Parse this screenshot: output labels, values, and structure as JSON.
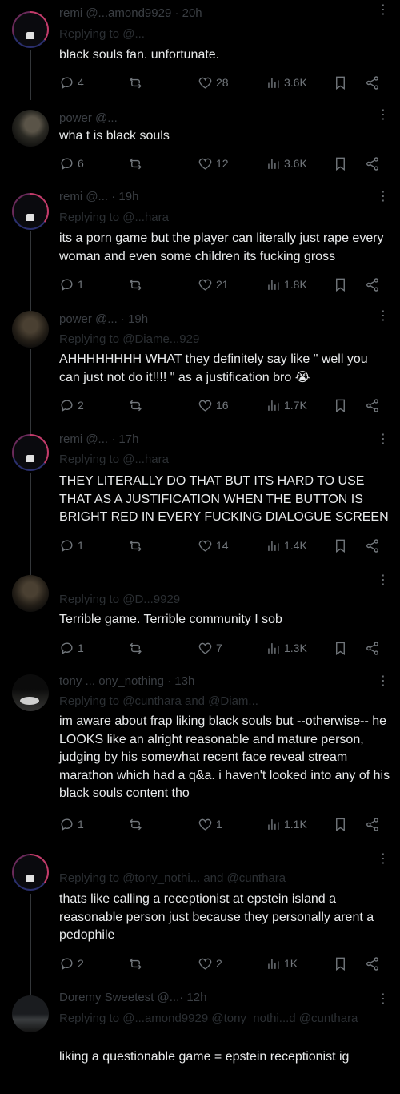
{
  "tweets": [
    {
      "header": "remi @...amond9929 · 20h",
      "replying": "Replying to @...",
      "text": "black souls fan. unfortunate.",
      "replies": "4",
      "reposts": "",
      "likes": "28",
      "views": "3.6K"
    },
    {
      "header": "power @...",
      "replying": "",
      "text": "wha t is black souls",
      "replies": "6",
      "reposts": "",
      "likes": "12",
      "views": "3.6K"
    },
    {
      "header": "remi @... · 19h",
      "replying": "Replying to @...hara",
      "text": "its a porn game but the player can literally just rape every woman and even some children its fucking gross",
      "replies": "1",
      "reposts": "",
      "likes": "21",
      "views": "1.8K"
    },
    {
      "header": "power @... · 19h",
      "replying": "Replying to @Diame...929",
      "text": "AHHHHHHHH WHAT they definitely say like \" well you can just not do it!!!! \" as a justification bro 😭",
      "replies": "2",
      "reposts": "",
      "likes": "16",
      "views": "1.7K"
    },
    {
      "header": "remi @... · 17h",
      "replying": "Replying to @...hara",
      "text": "THEY LITERALLY DO THAT BUT ITS HARD TO USE THAT AS A JUSTIFICATION WHEN THE BUTTON IS BRIGHT RED IN EVERY FUCKING DIALOGUE SCREEN",
      "replies": "1",
      "reposts": "",
      "likes": "14",
      "views": "1.4K"
    },
    {
      "header": "",
      "replying": "Replying to @D...9929",
      "text": "Terrible game. Terrible community I sob",
      "replies": "1",
      "reposts": "",
      "likes": "7",
      "views": "1.3K"
    },
    {
      "header": "tony ... ony_nothing · 13h",
      "replying": "Replying to @cunthara and @Diam...",
      "text": "im aware about frap liking black souls but --otherwise-- he LOOKS like an alright reasonable and mature person, judging by his somewhat recent face reveal stream marathon which had a q&a. i haven't looked into any of his black souls content tho",
      "replies": "1",
      "reposts": "",
      "likes": "1",
      "views": "1.1K"
    },
    {
      "header": "",
      "replying": "Replying to @tony_nothi... and @cunthara",
      "text": "thats like calling a receptionist at epstein island a reasonable person just because they personally arent a pedophile",
      "replies": "2",
      "reposts": "",
      "likes": "2",
      "views": "1K"
    },
    {
      "header": "Doremy Sweetest @...· 12h",
      "replying": "Replying to @...amond9929 @tony_nothi...d @cunthara",
      "text": "liking a questionable game = epstein receptionist ig",
      "replies": "",
      "reposts": "",
      "likes": "",
      "views": ""
    }
  ]
}
